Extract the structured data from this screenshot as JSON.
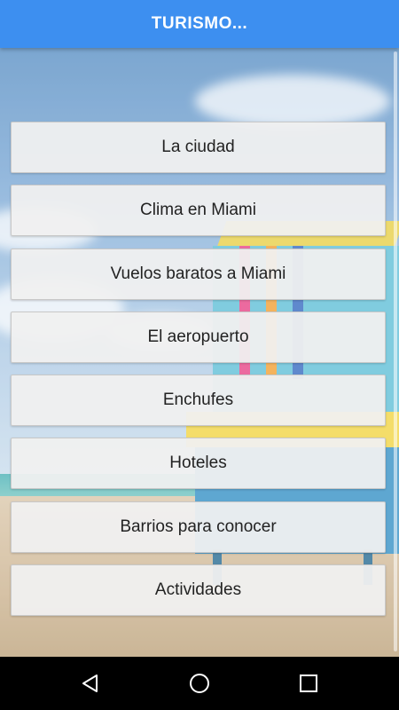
{
  "app_bar": {
    "title": "TURISMO..."
  },
  "menu": {
    "items": [
      {
        "label": "La ciudad"
      },
      {
        "label": "Clima en Miami"
      },
      {
        "label": "Vuelos baratos a Miami"
      },
      {
        "label": "El aeropuerto"
      },
      {
        "label": "Enchufes"
      },
      {
        "label": "Hoteles"
      },
      {
        "label": "Barrios para conocer"
      },
      {
        "label": "Actividades"
      }
    ]
  },
  "nav_bar": {
    "buttons": [
      "back-icon",
      "home-icon",
      "recents-icon"
    ]
  },
  "colors": {
    "app_bar": "#3d8ff0",
    "menu_item_bg": "#f0f0f0",
    "nav_bar": "#000000"
  }
}
